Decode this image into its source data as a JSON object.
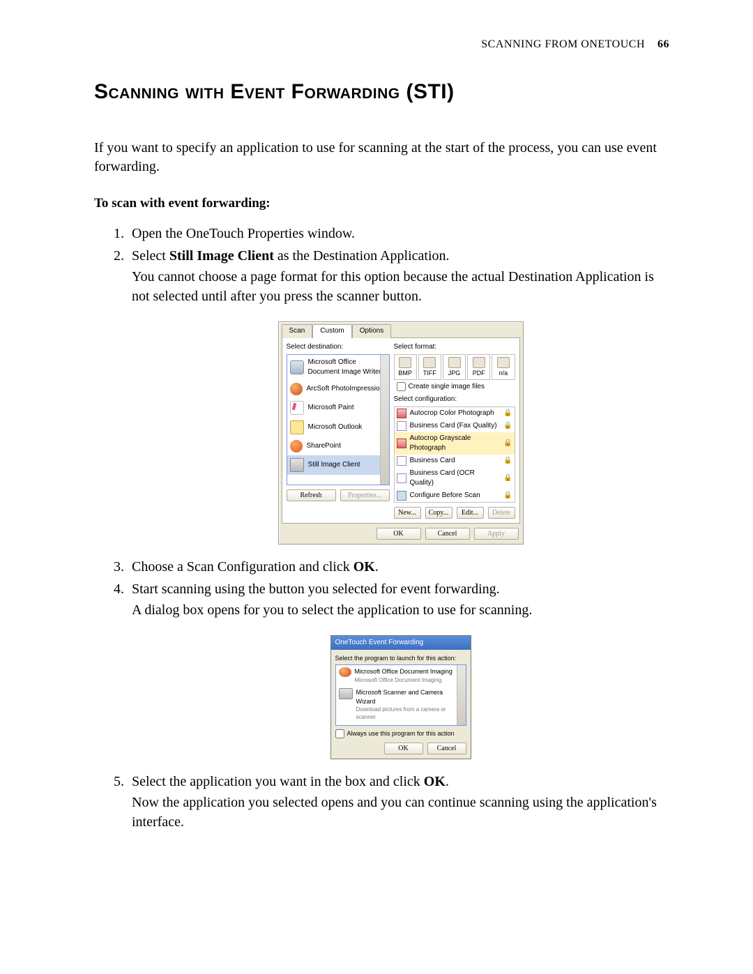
{
  "header": {
    "section": "Scanning From OneTouch",
    "page": "66"
  },
  "title": "Scanning with Event Forwarding (STI)",
  "intro": "If you want to specify an application to use for scanning at the start of the process, you can use event forwarding.",
  "subhead": "To scan with event forwarding:",
  "steps": {
    "s1": "Open the OneTouch Properties window.",
    "s2a": "Select ",
    "s2b": "Still Image Client",
    "s2c": " as the Destination Application.",
    "s2note": "You cannot choose a page format for this option because the actual Destination Application is not selected until after you press the scanner button.",
    "s3a": "Choose a Scan Configuration and click ",
    "s3b": "OK",
    "s3c": ".",
    "s4": "Start scanning using the button you selected for event forwarding.",
    "s4note": "A dialog box opens for you to select the application to use for scanning.",
    "s5a": "Select the application you want in the box and click ",
    "s5b": "OK",
    "s5c": ".",
    "s5note": "Now the application you selected opens and you can continue scanning using the application's interface."
  },
  "dlg1": {
    "tabs": [
      "Scan",
      "Custom",
      "Options"
    ],
    "selDestLabel": "Select destination:",
    "destinations": [
      "Microsoft Office Document Image Writer",
      "ArcSoft PhotoImpression",
      "Microsoft Paint",
      "Microsoft Outlook",
      "SharePoint",
      "Still Image Client"
    ],
    "selFmtLabel": "Select format:",
    "formats": [
      "BMP",
      "TIFF",
      "JPG",
      "PDF",
      "n/a"
    ],
    "createSingle": "Create single image files",
    "selCfgLabel": "Select configuration:",
    "configs": [
      "Autocrop Color Photograph",
      "Business Card (Fax Quality)",
      "Autocrop Grayscale Photograph",
      "Business Card",
      "Business Card (OCR Quality)",
      "Configure Before Scan"
    ],
    "btnRefresh": "Refresh",
    "btnProps": "Properties...",
    "btnNew": "New...",
    "btnCopy": "Copy...",
    "btnEdit": "Edit...",
    "btnDelete": "Delete",
    "btnOK": "OK",
    "btnCancel": "Cancel",
    "btnApply": "Apply"
  },
  "dlg2": {
    "title": "OneTouch Event Forwarding",
    "prompt": "Select the program to launch for this action:",
    "items": [
      {
        "t": "Microsoft Office Document Imaging",
        "s": "Microsoft Office Document Imaging"
      },
      {
        "t": "Microsoft Scanner and Camera Wizard",
        "s": "Download pictures from a camera or scanner"
      }
    ],
    "always": "Always use this program for this action",
    "ok": "OK",
    "cancel": "Cancel"
  }
}
